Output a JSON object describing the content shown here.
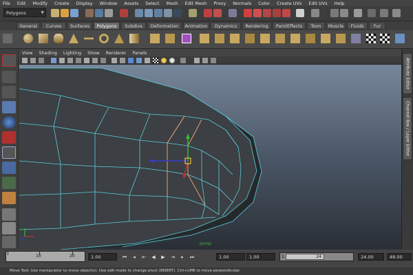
{
  "menus": [
    "File",
    "Edit",
    "Modify",
    "Create",
    "Display",
    "Window",
    "Assets",
    "Select",
    "Mesh",
    "Edit Mesh",
    "Proxy",
    "Normals",
    "Color",
    "Create UVs",
    "Edit UVs",
    "Help"
  ],
  "mode_selector": {
    "value": "Polygons"
  },
  "shelf_tabs": [
    {
      "label": "General",
      "active": false
    },
    {
      "label": "Curves",
      "active": false
    },
    {
      "label": "Surfaces",
      "active": false
    },
    {
      "label": "Polygons",
      "active": true
    },
    {
      "label": "Subdivs",
      "active": false
    },
    {
      "label": "Deformation",
      "active": false
    },
    {
      "label": "Animation",
      "active": false
    },
    {
      "label": "Dynamics",
      "active": false
    },
    {
      "label": "Rendering",
      "active": false
    },
    {
      "label": "PaintEffects",
      "active": false
    },
    {
      "label": "Toon",
      "active": false
    },
    {
      "label": "Muscle",
      "active": false
    },
    {
      "label": "Fluids",
      "active": false
    },
    {
      "label": "Fur",
      "active": false
    }
  ],
  "panel_menu": [
    "View",
    "Shading",
    "Lighting",
    "Show",
    "Renderer",
    "Panels"
  ],
  "right_tabs": [
    "Attribute Editor",
    "Channel Box / Layer Editor"
  ],
  "viewport": {
    "axis_label": "persp"
  },
  "time_slider": {
    "ticks": [
      "10",
      "20"
    ]
  },
  "time_fields": {
    "current": "1.00",
    "start": "1.00",
    "range_start": "1.00",
    "range_min": "1",
    "range_max": "24",
    "end": "24.00",
    "anim_end": "48.00"
  },
  "help_line": "Move Tool: Use manipulator to move object(s). Use edit mode to change pivot (INSERT).  Ctrl+LMB to move perpendicular.",
  "colors": {
    "accent_active_tab": "#6a6a6a",
    "mesh_wire": "#5ad0e0",
    "selection_wire": "#e8a070",
    "manip_x": "#3a3ad0",
    "manip_y": "#30c030",
    "manip_z": "#c03030"
  }
}
